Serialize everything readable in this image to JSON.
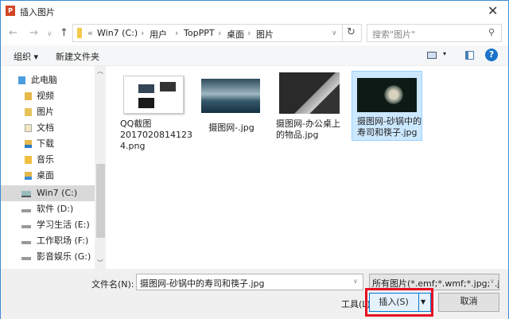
{
  "window": {
    "title": "插入图片",
    "app_icon": "P",
    "close": "✕"
  },
  "address": {
    "segments": [
      "«",
      "Win7 (C:)",
      "›",
      "用户",
      "›",
      "TopPPT",
      "›",
      "桌面",
      "›",
      "图片"
    ],
    "search_placeholder": "搜索\"图片\""
  },
  "toolbar": {
    "organize": "组织 ▾",
    "new_folder": "新建文件夹"
  },
  "nav_pane": [
    {
      "label": "此电脑",
      "icon": "computer-icon"
    },
    {
      "label": "视频",
      "icon": "video-folder-icon"
    },
    {
      "label": "图片",
      "icon": "pictures-folder-icon"
    },
    {
      "label": "文档",
      "icon": "documents-folder-icon"
    },
    {
      "label": "下载",
      "icon": "downloads-folder-icon"
    },
    {
      "label": "音乐",
      "icon": "music-folder-icon"
    },
    {
      "label": "桌面",
      "icon": "desktop-folder-icon"
    },
    {
      "label": "Win7 (C:)",
      "icon": "drive-icon",
      "selected": true
    },
    {
      "label": "软件 (D:)",
      "icon": "drive-icon"
    },
    {
      "label": "学习生活 (E:)",
      "icon": "drive-icon"
    },
    {
      "label": "工作职场 (F:)",
      "icon": "drive-icon"
    },
    {
      "label": "影音娱乐 (G:)",
      "icon": "drive-icon"
    }
  ],
  "files": [
    {
      "name": "QQ截图20170208141234.png",
      "line1": "QQ截图",
      "line2": "2017020814123",
      "line3": "4.png"
    },
    {
      "name": "摄图网-.jpg",
      "line1": "摄图网-.jpg"
    },
    {
      "name": "摄图网-办公桌上的物品.jpg",
      "line1": "摄图网-办公桌上",
      "line2": "的物品.jpg"
    },
    {
      "name": "摄图网-砂锅中的寿司和筷子.jpg",
      "line1": "摄图网-砂锅中的",
      "line2": "寿司和筷子.jpg",
      "selected": true
    }
  ],
  "bottom": {
    "filename_label": "文件名(N):",
    "filename_value": "摄图网-砂锅中的寿司和筷子.jpg",
    "filter": "所有图片(*.emf;*.wmf;*.jpg;*.j",
    "tools": "工具(L)",
    "insert": "插入(S)",
    "cancel": "取消"
  },
  "colors": {
    "highlight": "#cce8ff",
    "red_box": "#e81123",
    "accent": "#0078d7"
  }
}
